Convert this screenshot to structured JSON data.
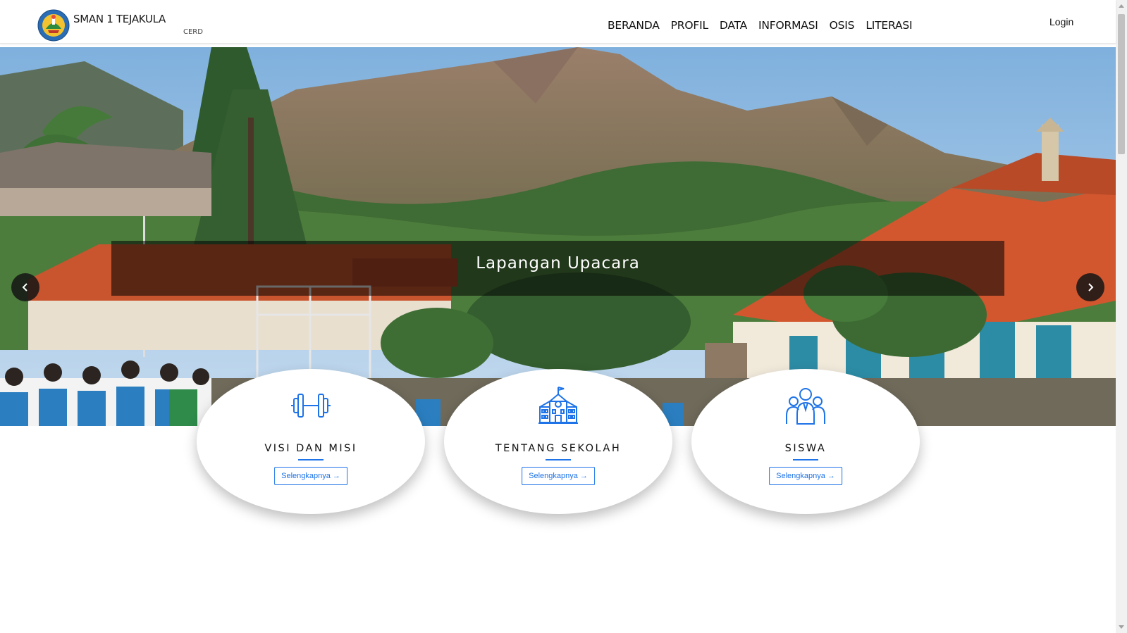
{
  "site": {
    "name": "SMAN 1 TEJAKULA",
    "marquee_text": "CERD"
  },
  "nav": {
    "items": [
      {
        "label": "BERANDA"
      },
      {
        "label": "PROFIL"
      },
      {
        "label": "DATA"
      },
      {
        "label": "INFORMASI"
      },
      {
        "label": "OSIS"
      },
      {
        "label": "LITERASI"
      }
    ],
    "login_label": "Login"
  },
  "carousel": {
    "caption": "Lapangan Upacara",
    "slide_count": 3,
    "active_slide": 3,
    "prev_icon": "chevron-left-icon",
    "next_icon": "chevron-right-icon"
  },
  "cards": [
    {
      "title": "VISI DAN MISI",
      "button": "Selengkapnya →",
      "icon": "dumbbell-icon"
    },
    {
      "title": "TENTANG SEKOLAH",
      "button": "Selengkapnya →",
      "icon": "school-building-icon"
    },
    {
      "title": "SISWA",
      "button": "Selengkapnya →",
      "icon": "students-group-icon"
    }
  ],
  "colors": {
    "accent": "#1e73e8",
    "caption_bg": "rgba(0,0,0,0.55)",
    "roof": "#d2572f",
    "sky": "#8fb8e0"
  }
}
